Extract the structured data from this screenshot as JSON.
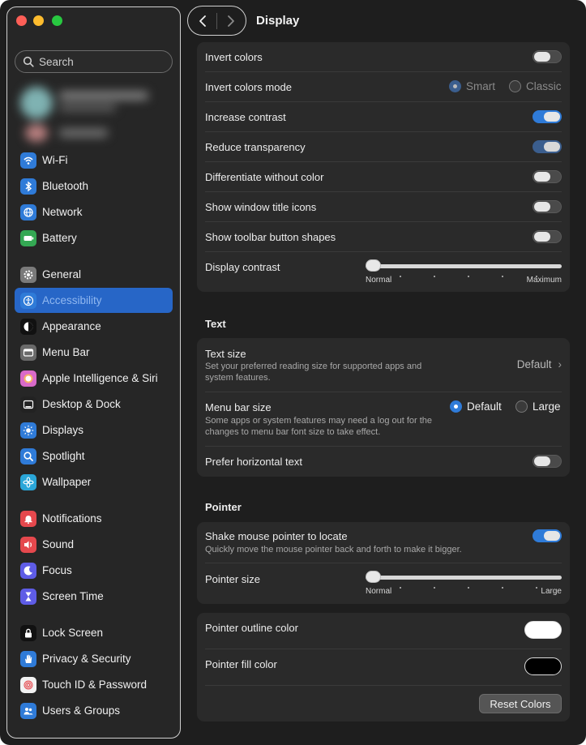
{
  "window": {
    "title": "Display"
  },
  "sidebar": {
    "search_placeholder": "Search",
    "items": [
      {
        "label": "Wi-Fi",
        "icon": "wifi-icon",
        "color": "#2f7bd8"
      },
      {
        "label": "Bluetooth",
        "icon": "bluetooth-icon",
        "color": "#2f7bd8"
      },
      {
        "label": "Network",
        "icon": "network-globe-icon",
        "color": "#2f7bd8"
      },
      {
        "label": "Battery",
        "icon": "battery-icon",
        "color": "#34a853"
      },
      {
        "label": "General",
        "icon": "gear-icon",
        "color": "#7a7a7a"
      },
      {
        "label": "Accessibility",
        "icon": "accessibility-icon",
        "color": "#2f7bd8"
      },
      {
        "label": "Appearance",
        "icon": "appearance-icon",
        "color": "#111111"
      },
      {
        "label": "Menu Bar",
        "icon": "menu-bar-icon",
        "color": "#6a6a6a"
      },
      {
        "label": "Apple Intelligence & Siri",
        "icon": "siri-icon",
        "color": "#d96ac9"
      },
      {
        "label": "Desktop & Dock",
        "icon": "dock-icon",
        "color": "#222222"
      },
      {
        "label": "Displays",
        "icon": "sun-icon",
        "color": "#2f7bd8"
      },
      {
        "label": "Spotlight",
        "icon": "magnifier-icon",
        "color": "#2f7bd8"
      },
      {
        "label": "Wallpaper",
        "icon": "flower-icon",
        "color": "#2aa6d8"
      },
      {
        "label": "Notifications",
        "icon": "bell-icon",
        "color": "#e5484d"
      },
      {
        "label": "Sound",
        "icon": "speaker-icon",
        "color": "#e5484d"
      },
      {
        "label": "Focus",
        "icon": "moon-icon",
        "color": "#5e5ce6"
      },
      {
        "label": "Screen Time",
        "icon": "hourglass-icon",
        "color": "#5e5ce6"
      },
      {
        "label": "Lock Screen",
        "icon": "lock-icon",
        "color": "#111111"
      },
      {
        "label": "Privacy & Security",
        "icon": "hand-icon",
        "color": "#2f7bd8"
      },
      {
        "label": "Touch ID & Password",
        "icon": "fingerprint-icon",
        "color": "#f2f2f2"
      },
      {
        "label": "Users & Groups",
        "icon": "users-icon",
        "color": "#2f7bd8"
      }
    ],
    "selected": "Accessibility"
  },
  "display": {
    "invert_colors": {
      "label": "Invert colors",
      "on": false
    },
    "invert_mode": {
      "label": "Invert colors mode",
      "opt1": "Smart",
      "opt2": "Classic",
      "selected": "Smart"
    },
    "increase_contrast": {
      "label": "Increase contrast",
      "on": true
    },
    "reduce_transparency": {
      "label": "Reduce transparency",
      "on": true
    },
    "differentiate": {
      "label": "Differentiate without color",
      "on": false
    },
    "title_icons": {
      "label": "Show window title icons",
      "on": false
    },
    "toolbar_shapes": {
      "label": "Show toolbar button shapes",
      "on": false
    },
    "contrast": {
      "label": "Display contrast",
      "min": "Normal",
      "max": "Maximum",
      "value": 0
    }
  },
  "text": {
    "heading": "Text",
    "text_size": {
      "label": "Text size",
      "desc": "Set your preferred reading size for supported apps and system features.",
      "value": "Default"
    },
    "menu_bar_size": {
      "label": "Menu bar size",
      "desc": "Some apps or system features may need a log out for the changes to menu bar font size to take effect.",
      "opt1": "Default",
      "opt2": "Large",
      "selected": "Default"
    },
    "horizontal": {
      "label": "Prefer horizontal text",
      "on": false
    }
  },
  "pointer": {
    "heading": "Pointer",
    "shake": {
      "label": "Shake mouse pointer to locate",
      "desc": "Quickly move the mouse pointer back and forth to make it bigger.",
      "on": true
    },
    "size": {
      "label": "Pointer size",
      "min": "Normal",
      "max": "Large",
      "value": 0
    },
    "outline": {
      "label": "Pointer outline color",
      "color": "#ffffff"
    },
    "fill": {
      "label": "Pointer fill color",
      "color": "#000000"
    },
    "reset": "Reset Colors"
  }
}
